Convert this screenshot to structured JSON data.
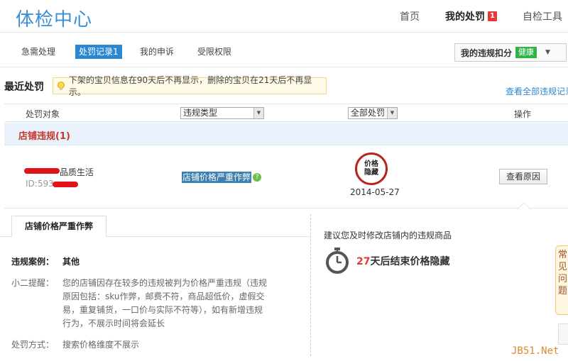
{
  "header": {
    "logo": "体检中心",
    "nav": [
      {
        "label": "首页"
      },
      {
        "label": "我的处罚",
        "badge": "1"
      },
      {
        "label": "自检工具"
      }
    ]
  },
  "tabs": [
    "急需处理",
    "处罚记录1",
    "我的申诉",
    "受限权限"
  ],
  "score": {
    "label": "我的违规扣分",
    "status": "健康",
    "caret": "▼"
  },
  "recent": {
    "title": "最近处罚",
    "notice": "下架的宝贝信息在90天后不再显示，删除的宝贝在21天后不再显示。",
    "view_all": "查看全部违规记录"
  },
  "table": {
    "col_target": "处罚对象",
    "filter_type": "违规类型",
    "filter_all": "全部处罚",
    "col_action": "操作"
  },
  "group": {
    "label": "店铺违规(1)"
  },
  "record": {
    "shop_name_suffix": "品质生活",
    "shop_id_prefix": "ID:593",
    "violation_type": "店铺价格严重作弊",
    "help_icon": "?",
    "penalty_seal": [
      "价格",
      "隐藏"
    ],
    "date": "2014-05-27",
    "action_label": "查看原因"
  },
  "detail": {
    "tab_title": "店铺价格严重作弊",
    "case_label": "违规案例：",
    "case_value": "其他",
    "tip_label": "小二提醒：",
    "tip_text": "您的店铺因存在较多的违规被判为价格严重违规（违规原因包括：sku作弊，邮费不符，商品超低价，虚假交易，重复铺货，一口价与实际不符等），如有新增违规行为，不展示时间将会延长",
    "method_label": "处罚方式：",
    "method_value": "搜索价格维度不展示",
    "suggest": "建议您及时修改店铺内的违规商品",
    "countdown_days": "27",
    "countdown_text": "天后结束价格隐藏"
  },
  "side_float": "常见问题",
  "watermark": "JB51.Net",
  "colors": {
    "brand": "#3a8fd6",
    "active_tab": "#2b87d1",
    "alert": "#e4393c",
    "healthy": "#2fb344"
  }
}
